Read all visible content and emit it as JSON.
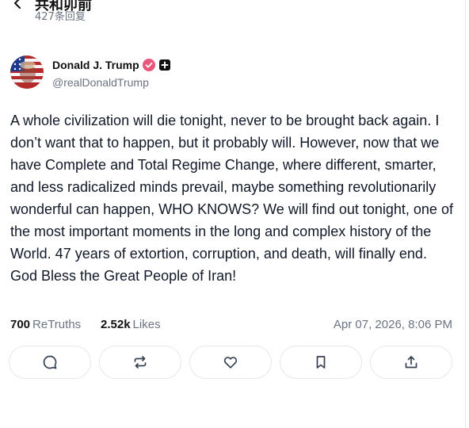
{
  "header": {
    "title": "共和卯前",
    "reply_count": "427条回复"
  },
  "post": {
    "author_name": "Donald J. Trump",
    "handle": "@realDonaldTrump",
    "text": "A whole civilization will die tonight, never to be brought back again. I don’t want that to happen, but it probably will. However, now that we have Complete and Total Regime Change, where different, smarter, and less radicalized minds prevail, maybe something revolutionarily wonderful can happen, WHO KNOWS? We will find out tonight, one of the most important moments in the long and complex history of the World. 47 years of extortion, corruption, and death, will finally end. God Bless the Great People of Iran!",
    "retruths_count": "700",
    "retruths_label": "ReTruths",
    "likes_count": "2.52k",
    "likes_label": "Likes",
    "timestamp": "Apr 07, 2026, 8:06 PM"
  },
  "actions": [
    {
      "name": "reply",
      "icon": "comment-icon"
    },
    {
      "name": "retruth",
      "icon": "repost-icon"
    },
    {
      "name": "like",
      "icon": "heart-icon"
    },
    {
      "name": "bookmark",
      "icon": "bookmark-icon"
    },
    {
      "name": "share",
      "icon": "share-icon"
    }
  ],
  "colors": {
    "verified": "#e8567c",
    "muted_text": "#6b7280",
    "border": "#e5e7eb"
  }
}
